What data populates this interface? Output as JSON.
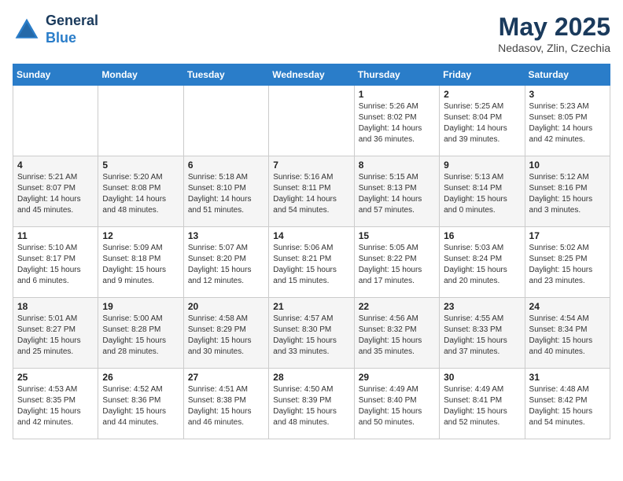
{
  "header": {
    "logo_line1": "General",
    "logo_line2": "Blue",
    "month_title": "May 2025",
    "subtitle": "Nedasov, Zlin, Czechia"
  },
  "weekdays": [
    "Sunday",
    "Monday",
    "Tuesday",
    "Wednesday",
    "Thursday",
    "Friday",
    "Saturday"
  ],
  "weeks": [
    [
      {
        "day": "",
        "sunrise": "",
        "sunset": "",
        "daylight": ""
      },
      {
        "day": "",
        "sunrise": "",
        "sunset": "",
        "daylight": ""
      },
      {
        "day": "",
        "sunrise": "",
        "sunset": "",
        "daylight": ""
      },
      {
        "day": "",
        "sunrise": "",
        "sunset": "",
        "daylight": ""
      },
      {
        "day": "1",
        "sunrise": "Sunrise: 5:26 AM",
        "sunset": "Sunset: 8:02 PM",
        "daylight": "Daylight: 14 hours and 36 minutes."
      },
      {
        "day": "2",
        "sunrise": "Sunrise: 5:25 AM",
        "sunset": "Sunset: 8:04 PM",
        "daylight": "Daylight: 14 hours and 39 minutes."
      },
      {
        "day": "3",
        "sunrise": "Sunrise: 5:23 AM",
        "sunset": "Sunset: 8:05 PM",
        "daylight": "Daylight: 14 hours and 42 minutes."
      }
    ],
    [
      {
        "day": "4",
        "sunrise": "Sunrise: 5:21 AM",
        "sunset": "Sunset: 8:07 PM",
        "daylight": "Daylight: 14 hours and 45 minutes."
      },
      {
        "day": "5",
        "sunrise": "Sunrise: 5:20 AM",
        "sunset": "Sunset: 8:08 PM",
        "daylight": "Daylight: 14 hours and 48 minutes."
      },
      {
        "day": "6",
        "sunrise": "Sunrise: 5:18 AM",
        "sunset": "Sunset: 8:10 PM",
        "daylight": "Daylight: 14 hours and 51 minutes."
      },
      {
        "day": "7",
        "sunrise": "Sunrise: 5:16 AM",
        "sunset": "Sunset: 8:11 PM",
        "daylight": "Daylight: 14 hours and 54 minutes."
      },
      {
        "day": "8",
        "sunrise": "Sunrise: 5:15 AM",
        "sunset": "Sunset: 8:13 PM",
        "daylight": "Daylight: 14 hours and 57 minutes."
      },
      {
        "day": "9",
        "sunrise": "Sunrise: 5:13 AM",
        "sunset": "Sunset: 8:14 PM",
        "daylight": "Daylight: 15 hours and 0 minutes."
      },
      {
        "day": "10",
        "sunrise": "Sunrise: 5:12 AM",
        "sunset": "Sunset: 8:16 PM",
        "daylight": "Daylight: 15 hours and 3 minutes."
      }
    ],
    [
      {
        "day": "11",
        "sunrise": "Sunrise: 5:10 AM",
        "sunset": "Sunset: 8:17 PM",
        "daylight": "Daylight: 15 hours and 6 minutes."
      },
      {
        "day": "12",
        "sunrise": "Sunrise: 5:09 AM",
        "sunset": "Sunset: 8:18 PM",
        "daylight": "Daylight: 15 hours and 9 minutes."
      },
      {
        "day": "13",
        "sunrise": "Sunrise: 5:07 AM",
        "sunset": "Sunset: 8:20 PM",
        "daylight": "Daylight: 15 hours and 12 minutes."
      },
      {
        "day": "14",
        "sunrise": "Sunrise: 5:06 AM",
        "sunset": "Sunset: 8:21 PM",
        "daylight": "Daylight: 15 hours and 15 minutes."
      },
      {
        "day": "15",
        "sunrise": "Sunrise: 5:05 AM",
        "sunset": "Sunset: 8:22 PM",
        "daylight": "Daylight: 15 hours and 17 minutes."
      },
      {
        "day": "16",
        "sunrise": "Sunrise: 5:03 AM",
        "sunset": "Sunset: 8:24 PM",
        "daylight": "Daylight: 15 hours and 20 minutes."
      },
      {
        "day": "17",
        "sunrise": "Sunrise: 5:02 AM",
        "sunset": "Sunset: 8:25 PM",
        "daylight": "Daylight: 15 hours and 23 minutes."
      }
    ],
    [
      {
        "day": "18",
        "sunrise": "Sunrise: 5:01 AM",
        "sunset": "Sunset: 8:27 PM",
        "daylight": "Daylight: 15 hours and 25 minutes."
      },
      {
        "day": "19",
        "sunrise": "Sunrise: 5:00 AM",
        "sunset": "Sunset: 8:28 PM",
        "daylight": "Daylight: 15 hours and 28 minutes."
      },
      {
        "day": "20",
        "sunrise": "Sunrise: 4:58 AM",
        "sunset": "Sunset: 8:29 PM",
        "daylight": "Daylight: 15 hours and 30 minutes."
      },
      {
        "day": "21",
        "sunrise": "Sunrise: 4:57 AM",
        "sunset": "Sunset: 8:30 PM",
        "daylight": "Daylight: 15 hours and 33 minutes."
      },
      {
        "day": "22",
        "sunrise": "Sunrise: 4:56 AM",
        "sunset": "Sunset: 8:32 PM",
        "daylight": "Daylight: 15 hours and 35 minutes."
      },
      {
        "day": "23",
        "sunrise": "Sunrise: 4:55 AM",
        "sunset": "Sunset: 8:33 PM",
        "daylight": "Daylight: 15 hours and 37 minutes."
      },
      {
        "day": "24",
        "sunrise": "Sunrise: 4:54 AM",
        "sunset": "Sunset: 8:34 PM",
        "daylight": "Daylight: 15 hours and 40 minutes."
      }
    ],
    [
      {
        "day": "25",
        "sunrise": "Sunrise: 4:53 AM",
        "sunset": "Sunset: 8:35 PM",
        "daylight": "Daylight: 15 hours and 42 minutes."
      },
      {
        "day": "26",
        "sunrise": "Sunrise: 4:52 AM",
        "sunset": "Sunset: 8:36 PM",
        "daylight": "Daylight: 15 hours and 44 minutes."
      },
      {
        "day": "27",
        "sunrise": "Sunrise: 4:51 AM",
        "sunset": "Sunset: 8:38 PM",
        "daylight": "Daylight: 15 hours and 46 minutes."
      },
      {
        "day": "28",
        "sunrise": "Sunrise: 4:50 AM",
        "sunset": "Sunset: 8:39 PM",
        "daylight": "Daylight: 15 hours and 48 minutes."
      },
      {
        "day": "29",
        "sunrise": "Sunrise: 4:49 AM",
        "sunset": "Sunset: 8:40 PM",
        "daylight": "Daylight: 15 hours and 50 minutes."
      },
      {
        "day": "30",
        "sunrise": "Sunrise: 4:49 AM",
        "sunset": "Sunset: 8:41 PM",
        "daylight": "Daylight: 15 hours and 52 minutes."
      },
      {
        "day": "31",
        "sunrise": "Sunrise: 4:48 AM",
        "sunset": "Sunset: 8:42 PM",
        "daylight": "Daylight: 15 hours and 54 minutes."
      }
    ]
  ]
}
